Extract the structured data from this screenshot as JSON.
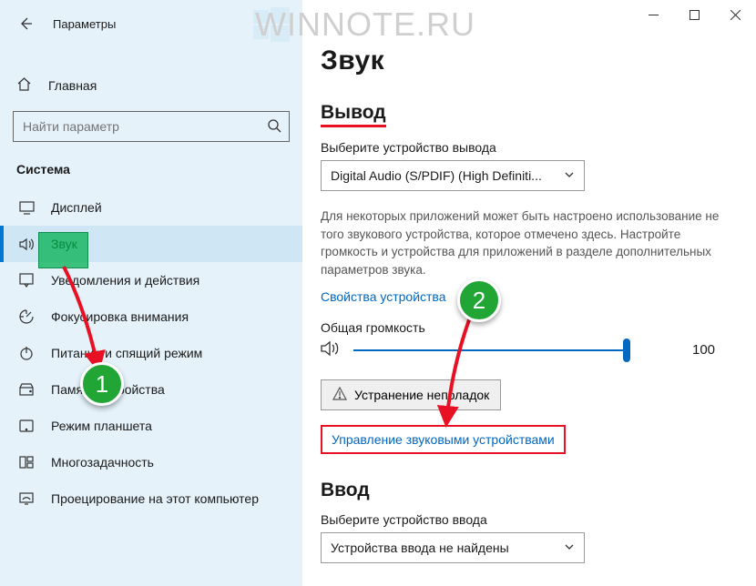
{
  "watermark": "WINNOTE.RU",
  "window": {
    "title": "Параметры"
  },
  "sidebar": {
    "home": "Главная",
    "search_placeholder": "Найти параметр",
    "group": "Система",
    "items": [
      {
        "label": "Дисплей"
      },
      {
        "label": "Звук"
      },
      {
        "label": "Уведомления и действия"
      },
      {
        "label": "Фокусировка внимания"
      },
      {
        "label": "Питание и спящий режим"
      },
      {
        "label": "Память устройства"
      },
      {
        "label": "Режим планшета"
      },
      {
        "label": "Многозадачность"
      },
      {
        "label": "Проецирование на этот компьютер"
      }
    ]
  },
  "main": {
    "title": "Звук",
    "output": {
      "heading": "Вывод",
      "device_label": "Выберите устройство вывода",
      "device_value": "Digital Audio (S/PDIF) (High Definiti...",
      "description": "Для некоторых приложений может быть настроено использование не того звукового устройства, которое отмечено здесь. Настройте громкость и устройства для приложений в разделе дополнительных параметров звука.",
      "device_props_link": "Свойства устройства",
      "volume_label": "Общая громкость",
      "volume_value": "100",
      "troubleshoot": "Устранение неполадок",
      "manage_link": "Управление звуковыми устройствами"
    },
    "input": {
      "heading": "Ввод",
      "device_label": "Выберите устройство ввода",
      "device_value": "Устройства ввода не найдены"
    }
  },
  "annotations": {
    "b1": "1",
    "b2": "2"
  }
}
